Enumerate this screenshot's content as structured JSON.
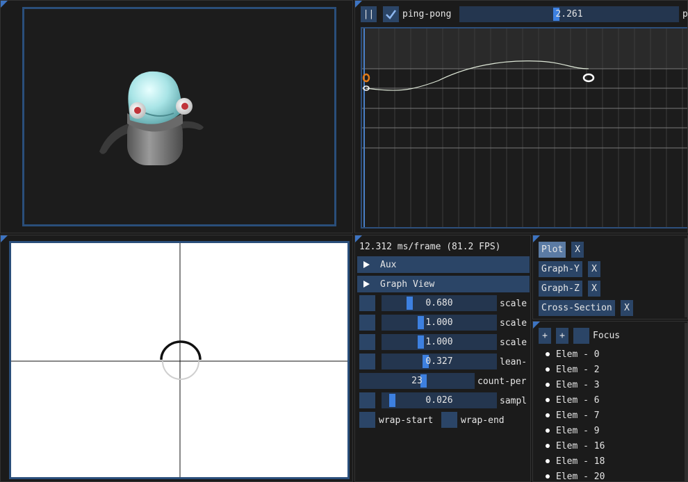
{
  "curve_editor": {
    "pause_label": "||",
    "pingpong_checked": true,
    "pingpong_label": "ping-pong",
    "time_value": "2.261",
    "time_fraction": 0.44,
    "overflow_label": "p"
  },
  "stats": {
    "frame_time": "12.312 ms/frame (81.2 FPS)"
  },
  "sections": {
    "aux": "Aux",
    "graph_view": "Graph View"
  },
  "sliders": [
    {
      "value": "0.680",
      "label": "scale",
      "fraction": 0.22
    },
    {
      "value": "1.000",
      "label": "scale",
      "fraction": 0.33
    },
    {
      "value": "1.000",
      "label": "scale",
      "fraction": 0.33
    },
    {
      "value": "0.327",
      "label": "lean-",
      "fraction": 0.37
    }
  ],
  "count": {
    "value": "23",
    "label": "count-per",
    "fraction": 0.56
  },
  "sample": {
    "value": "0.026",
    "label": "sampl",
    "fraction": 0.06
  },
  "wrap": {
    "start": "wrap-start",
    "end": "wrap-end"
  },
  "tabs": [
    {
      "label": "Plot",
      "active": true,
      "close": "X"
    },
    {
      "label": "Graph-Y",
      "active": false,
      "close": "X"
    },
    {
      "label": "Graph-Z",
      "active": false,
      "close": "X"
    },
    {
      "label": "Cross-Section",
      "active": false,
      "close": "X"
    }
  ],
  "list_toolbar": {
    "add1": "+",
    "add2": "+",
    "focus_label": "Focus"
  },
  "elements": [
    "Elem - 0",
    "Elem - 2",
    "Elem - 3",
    "Elem - 6",
    "Elem - 7",
    "Elem - 9",
    "Elem - 16",
    "Elem - 18",
    "Elem - 20"
  ],
  "colors": {
    "accent": "#3d80e0",
    "frame": "#2a4e7a",
    "button": "#2b4567",
    "keyframe": "#e07a1a"
  }
}
